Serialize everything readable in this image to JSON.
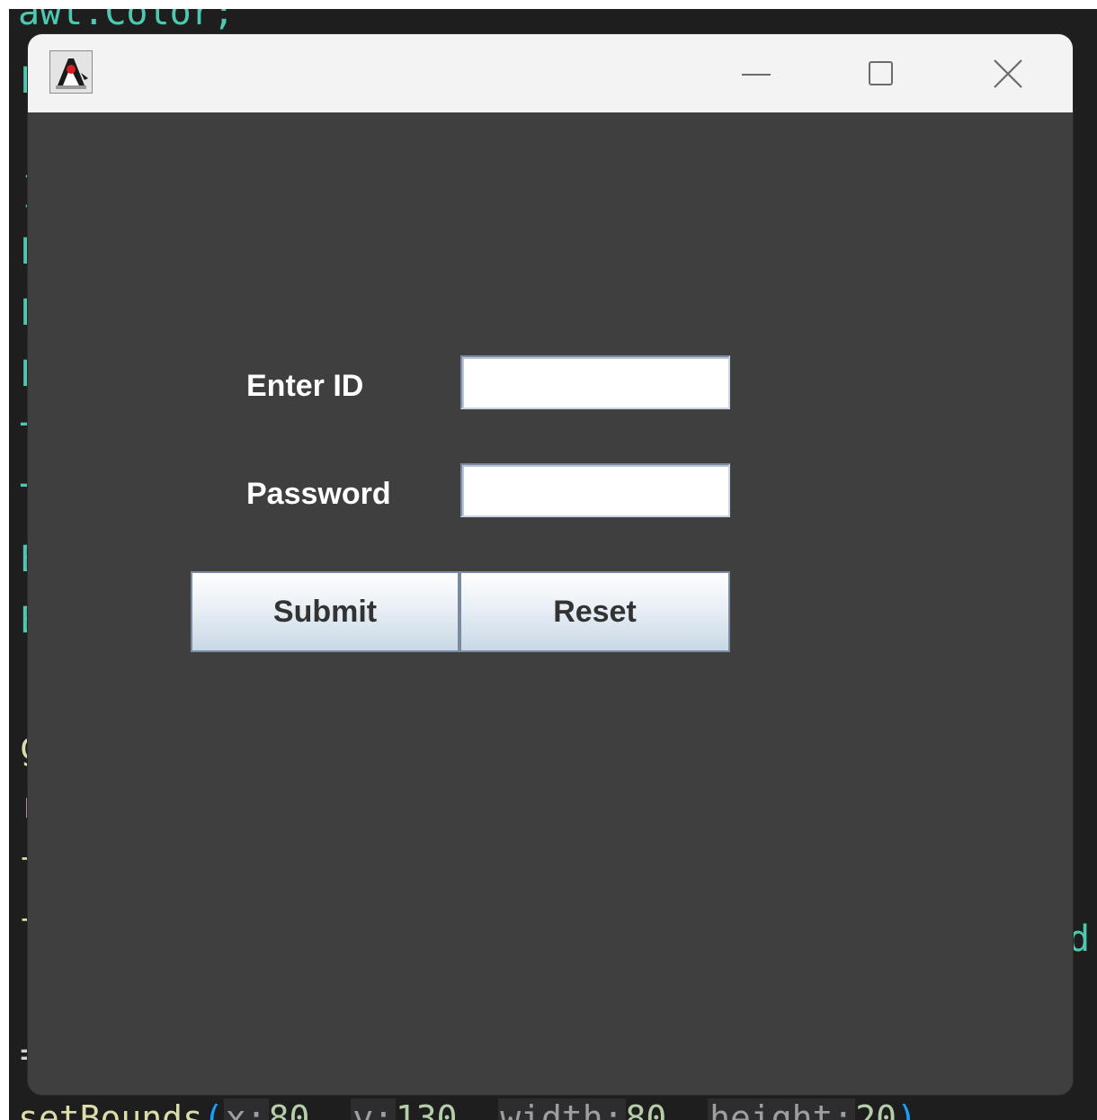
{
  "background_editor": {
    "top_line": "awt.Color;",
    "left_fragments": [
      "L",
      "]",
      "L",
      "L",
      "L",
      "T",
      "T",
      "E",
      "E",
      "g",
      "r",
      "t",
      "t",
      "="
    ],
    "right_fragment": "d",
    "bottom_line": {
      "method": "setBounds",
      "x_hint": "x:",
      "x_value": "80",
      "y_hint": "y:",
      "y_value": "130",
      "width_hint": "width:",
      "width_value": "80",
      "height_hint": "height:",
      "height_value": "20"
    }
  },
  "window": {
    "title_icon": "java-duke-icon",
    "controls": {
      "minimize_icon": "minimize-icon",
      "maximize_icon": "maximize-icon",
      "close_icon": "close-icon"
    }
  },
  "form": {
    "id_label": "Enter ID",
    "id_value": "",
    "password_label": "Password",
    "password_value": "",
    "submit_label": "Submit",
    "reset_label": "Reset"
  },
  "colors": {
    "window_background": "#3f3f3f",
    "titlebar": "#f3f3f3",
    "label_text": "#ffffff",
    "editor_background": "#1e1e1e"
  }
}
